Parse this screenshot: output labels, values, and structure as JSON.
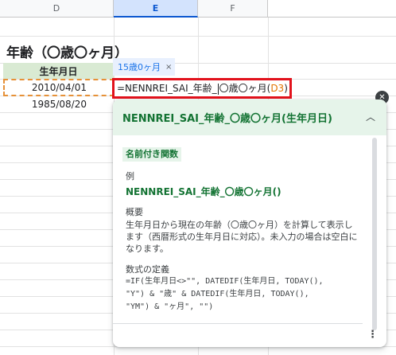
{
  "columns": [
    {
      "name": "D"
    },
    {
      "name": "E"
    },
    {
      "name": "F"
    }
  ],
  "sheet": {
    "title": "年齢（〇歳〇ヶ月）",
    "header": "生年月日",
    "dates": [
      "2010/04/01",
      "1985/08/20"
    ]
  },
  "chip": {
    "label": "15歳0ヶ月",
    "close": "×"
  },
  "editor": {
    "prefix": "=NENNREI_SAI_年齢_",
    "suffix": "〇歳〇ヶ月(",
    "ref": "D3",
    "close_paren": ")",
    "ref_color": "#e37400",
    "border_color": "#e2121c"
  },
  "help": {
    "title": "NENNREI_SAI_年齢_〇歳〇ヶ月(生年月日)",
    "badge": "名前付き関数",
    "example_label": "例",
    "example": "NENNREI_SAI_年齢_〇歳〇ヶ月()",
    "summary_label": "概要",
    "summary": "生年月日から現在の年齢（〇歳〇ヶ月）を計算して表示します（西暦形式の生年月日に対応）。未入力の場合は空白になります。",
    "definition_label": "数式の定義",
    "definition": "=IF(生年月日<>\"\", DATEDIF(生年月日, TODAY(),\n\"Y\") & \"歳\" & DATEDIF(生年月日, TODAY(),\n\"YM\") & \"ヶ月\", \"\")",
    "collapse_icon": "chevron-up-icon",
    "close_icon": "close-icon",
    "more_icon": "more-vert-icon"
  }
}
